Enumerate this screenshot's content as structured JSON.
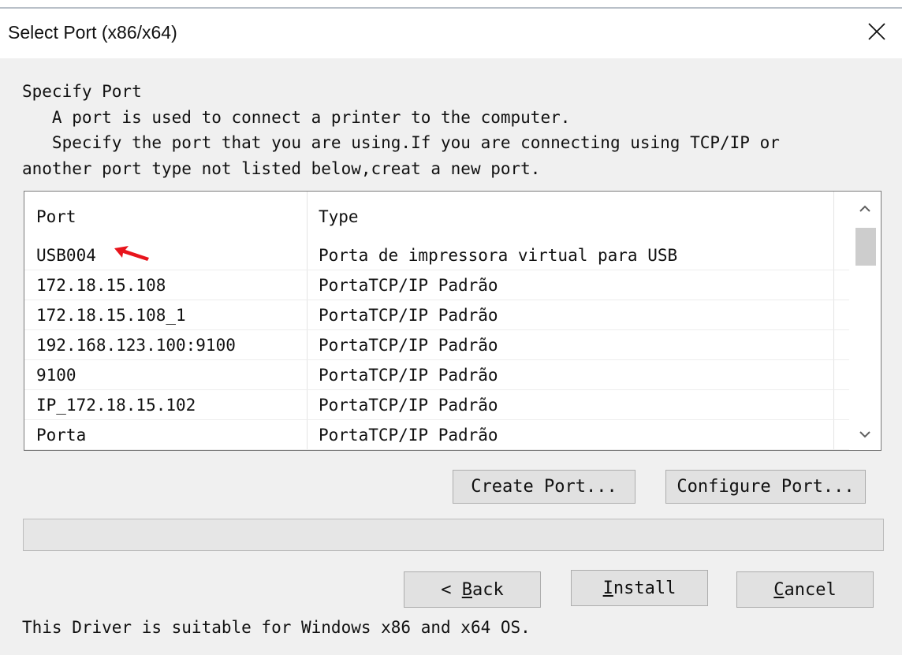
{
  "window": {
    "title": "Select Port (x86/x64)"
  },
  "description": {
    "heading": "Specify Port",
    "line1": "   A port is used to connect a printer to the computer.",
    "line2": "   Specify the port that you are using.If you are connecting using TCP/IP or",
    "line3": "another port type not listed below,creat a new port."
  },
  "port_list": {
    "columns": [
      "Port",
      "Type"
    ],
    "rows": [
      {
        "port": "USB004",
        "type": "Porta de impressora virtual para USB"
      },
      {
        "port": "172.18.15.108",
        "type": "PortaTCP/IP Padrão"
      },
      {
        "port": "172.18.15.108_1",
        "type": "PortaTCP/IP Padrão"
      },
      {
        "port": "192.168.123.100:9100",
        "type": "PortaTCP/IP Padrão"
      },
      {
        "port": "9100",
        "type": "PortaTCP/IP Padrão"
      },
      {
        "port": "IP_172.18.15.102",
        "type": "PortaTCP/IP Padrão"
      },
      {
        "port": "Porta",
        "type": "PortaTCP/IP Padrão"
      }
    ]
  },
  "buttons": {
    "create_port": "Create Port...",
    "configure_port": "Configure Port...",
    "back_prefix": "< ",
    "back_accel": "B",
    "back_rest": "ack",
    "install_accel": "I",
    "install_rest": "nstall",
    "cancel_accel": "C",
    "cancel_rest": "ancel"
  },
  "progress": {
    "value": 0
  },
  "footer": {
    "text": "This Driver is suitable for Windows x86 and x64 OS."
  },
  "icons": {
    "close": "close-icon",
    "scroll_up": "chevron-up-icon",
    "scroll_down": "chevron-down-icon",
    "annotation": "red-arrow-icon"
  },
  "colors": {
    "annotation_arrow": "#e8141c",
    "window_bg": "#f0f0f0",
    "button_bg": "#e1e1e1"
  }
}
